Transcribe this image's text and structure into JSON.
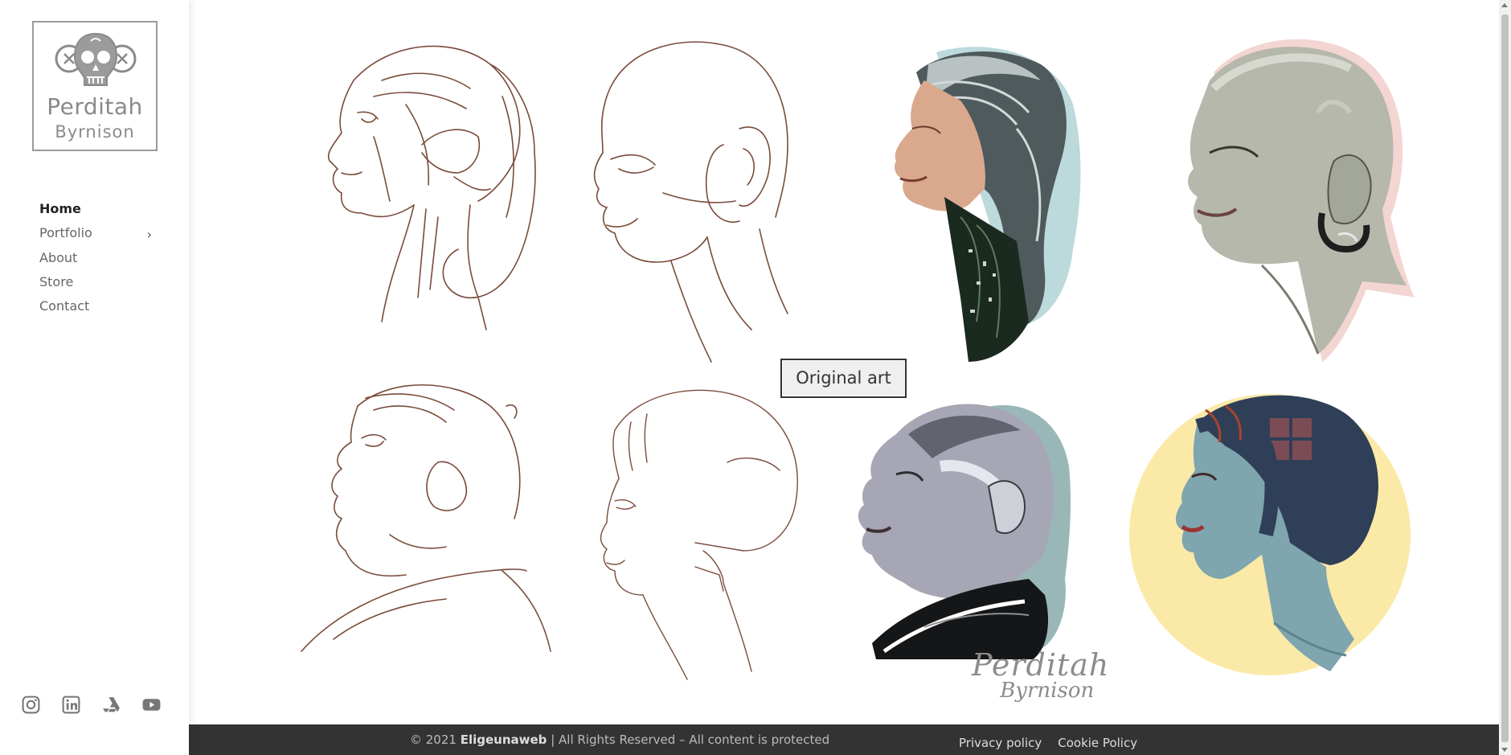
{
  "brand": {
    "first_name": "Perditah",
    "last_name": "Byrnison",
    "logo_icon": "sugar-skull-icon"
  },
  "nav": {
    "items": [
      {
        "label": "Home",
        "active": true
      },
      {
        "label": "Portfolio",
        "has_submenu": true
      },
      {
        "label": "About"
      },
      {
        "label": "Store"
      },
      {
        "label": "Contact"
      }
    ]
  },
  "social": [
    "instagram-icon",
    "linkedin-icon",
    "artstation-icon",
    "youtube-icon"
  ],
  "hero": {
    "cta_label": "Original art",
    "signature_line1": "Perditah",
    "signature_line2": "Byrnison"
  },
  "footer": {
    "copyright_prefix": "© 2021 ",
    "company": "Eligeunaweb",
    "copyright_suffix": " | All Rights Reserved – All content is protected",
    "links": [
      "Privacy policy",
      "Cookie Policy"
    ]
  },
  "colors": {
    "sketch": "#7a4b3a",
    "footer_bg": "#333333",
    "sunburst": "#fbe9a8",
    "teal_shadow": "#9ab7b8",
    "blue_skin": "#7fa5ae"
  }
}
